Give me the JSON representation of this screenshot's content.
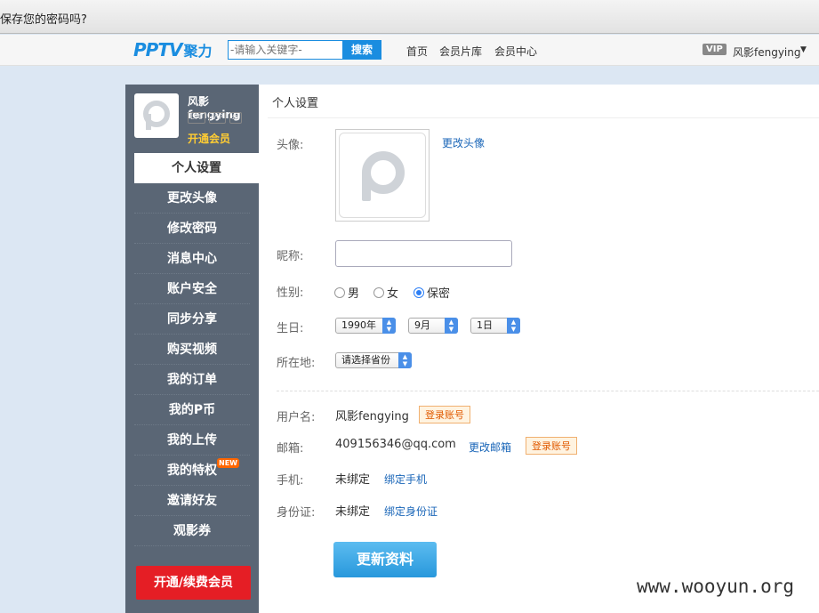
{
  "password_bar": {
    "text": "保存您的密码吗?"
  },
  "topnav": {
    "logo_pp": "PPTV",
    "logo_brand": "聚力",
    "search_placeholder": "-请输入关键字-",
    "search_button": "搜索",
    "links": [
      "首页",
      "会员片库",
      "会员中心"
    ],
    "vip_badge": "VIP",
    "username": "风影fengying",
    "caret": "▼"
  },
  "sidebar": {
    "username": "风影fengying",
    "badges": [
      "LV0",
      "VIP",
      "年"
    ],
    "open_member": "开通会员",
    "items": [
      "个人设置",
      "更改头像",
      "修改密码",
      "消息中心",
      "账户安全",
      "同步分享",
      "购买视频",
      "我的订单",
      "我的P币",
      "我的上传",
      "我的特权",
      "邀请好友",
      "观影券"
    ],
    "new_tag": "NEW",
    "renew_button": "开通/续费会员"
  },
  "main": {
    "title": "个人设置",
    "avatar_label": "头像:",
    "change_avatar": "更改头像",
    "nickname_label": "昵称:",
    "nickname_value": "",
    "gender_label": "性别:",
    "gender_options": [
      "男",
      "女",
      "保密"
    ],
    "gender_selected": "保密",
    "birthday_label": "生日:",
    "birth_year": "1990年",
    "birth_month": "9月",
    "birth_day": "1日",
    "location_label": "所在地:",
    "location_value": "请选择省份",
    "username_label": "用户名:",
    "username_value": "风影fengying",
    "login_account": "登录账号",
    "email_label": "邮箱:",
    "email_value": "409156346@qq.com",
    "change_email": "更改邮箱",
    "phone_label": "手机:",
    "phone_value": "未绑定",
    "bind_phone": "绑定手机",
    "id_label": "身份证:",
    "id_value": "未绑定",
    "bind_id": "绑定身份证",
    "update_button": "更新资料"
  },
  "watermark": "www.wooyun.org"
}
